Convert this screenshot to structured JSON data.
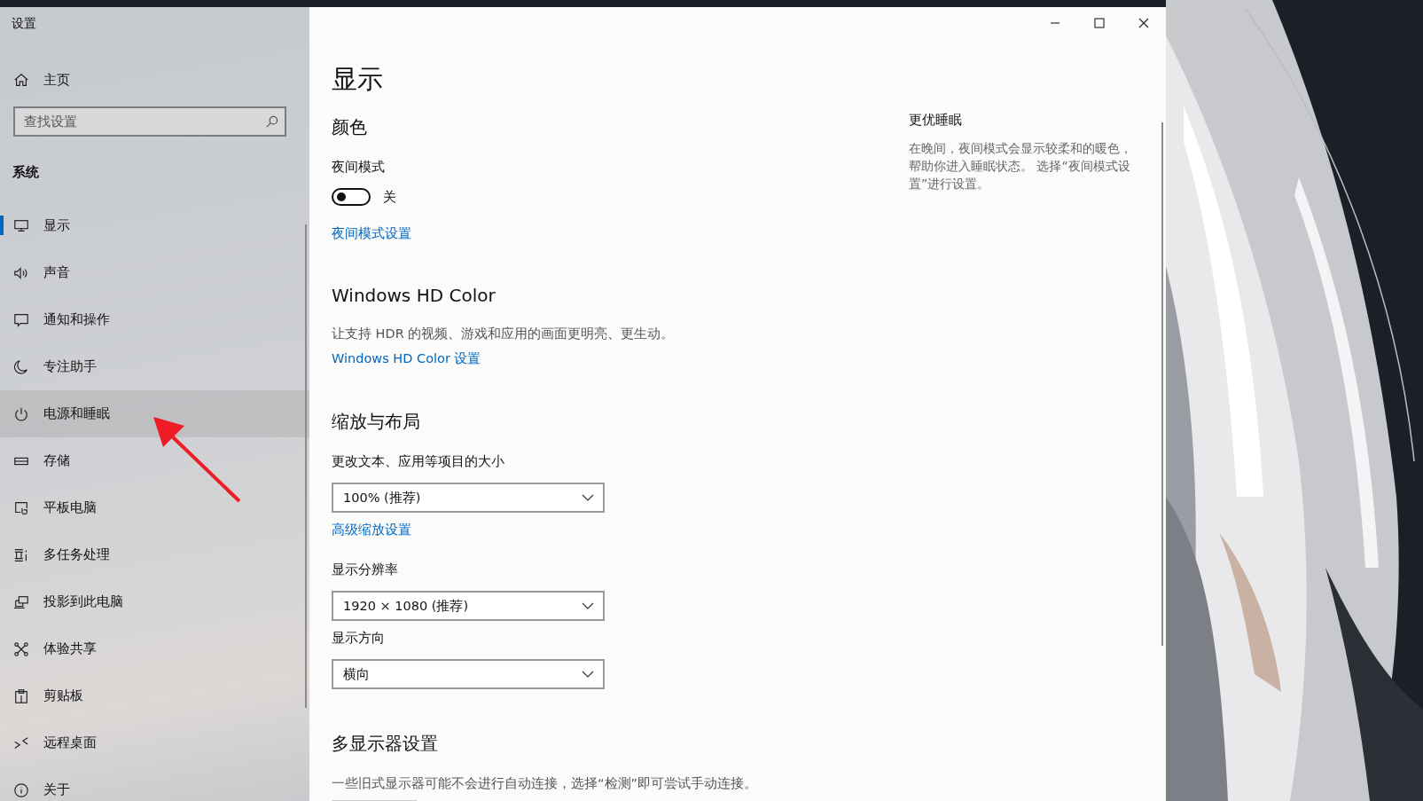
{
  "window": {
    "title": "设置"
  },
  "sidebar": {
    "home": "主页",
    "search": {
      "placeholder": "查找设置"
    },
    "section": "系统",
    "items": [
      {
        "label": "显示",
        "kind": "display",
        "selected": true,
        "hovered": false
      },
      {
        "label": "声音",
        "kind": "sound",
        "selected": false,
        "hovered": false
      },
      {
        "label": "通知和操作",
        "kind": "notification",
        "selected": false,
        "hovered": false
      },
      {
        "label": "专注助手",
        "kind": "moon",
        "selected": false,
        "hovered": false
      },
      {
        "label": "电源和睡眠",
        "kind": "power",
        "selected": false,
        "hovered": true
      },
      {
        "label": "存储",
        "kind": "storage",
        "selected": false,
        "hovered": false
      },
      {
        "label": "平板电脑",
        "kind": "tablet",
        "selected": false,
        "hovered": false
      },
      {
        "label": "多任务处理",
        "kind": "multitask",
        "selected": false,
        "hovered": false
      },
      {
        "label": "投影到此电脑",
        "kind": "project",
        "selected": false,
        "hovered": false
      },
      {
        "label": "体验共享",
        "kind": "share",
        "selected": false,
        "hovered": false
      },
      {
        "label": "剪贴板",
        "kind": "clipboard",
        "selected": false,
        "hovered": false
      },
      {
        "label": "远程桌面",
        "kind": "remote",
        "selected": false,
        "hovered": false
      },
      {
        "label": "关于",
        "kind": "about",
        "selected": false,
        "hovered": false
      }
    ]
  },
  "main": {
    "title": "显示",
    "sections": [
      {
        "heading": "颜色",
        "items": [
          {
            "kind": "label",
            "text": "夜间模式"
          },
          {
            "kind": "toggle",
            "on": false,
            "text": "关"
          },
          {
            "kind": "link",
            "text": "夜间模式设置"
          }
        ]
      },
      {
        "heading": "Windows HD Color",
        "items": [
          {
            "kind": "text",
            "text": "让支持 HDR 的视频、游戏和应用的画面更明亮、更生动。"
          },
          {
            "kind": "link",
            "text": "Windows HD Color 设置"
          }
        ]
      },
      {
        "heading": "缩放与布局",
        "items": [
          {
            "kind": "label",
            "text": "更改文本、应用等项目的大小"
          },
          {
            "kind": "dropdown",
            "value": "100% (推荐)"
          },
          {
            "kind": "link",
            "text": "高级缩放设置"
          },
          {
            "kind": "label",
            "text": "显示分辨率"
          },
          {
            "kind": "dropdown",
            "value": "1920 × 1080 (推荐)"
          },
          {
            "kind": "label",
            "text": "显示方向"
          },
          {
            "kind": "dropdown",
            "value": "横向"
          }
        ]
      },
      {
        "heading": "多显示器设置",
        "items": [
          {
            "kind": "text",
            "text": "一些旧式显示器可能不会进行自动连接，选择“检测”即可尝试手动连接。"
          },
          {
            "kind": "button"
          }
        ]
      }
    ]
  },
  "side_panel": {
    "heading": "更优睡眠",
    "text": "在晚间，夜间模式会显示较柔和的暖色，帮助你进入睡眠状态。 选择“夜间模式设置”进行设置。"
  }
}
